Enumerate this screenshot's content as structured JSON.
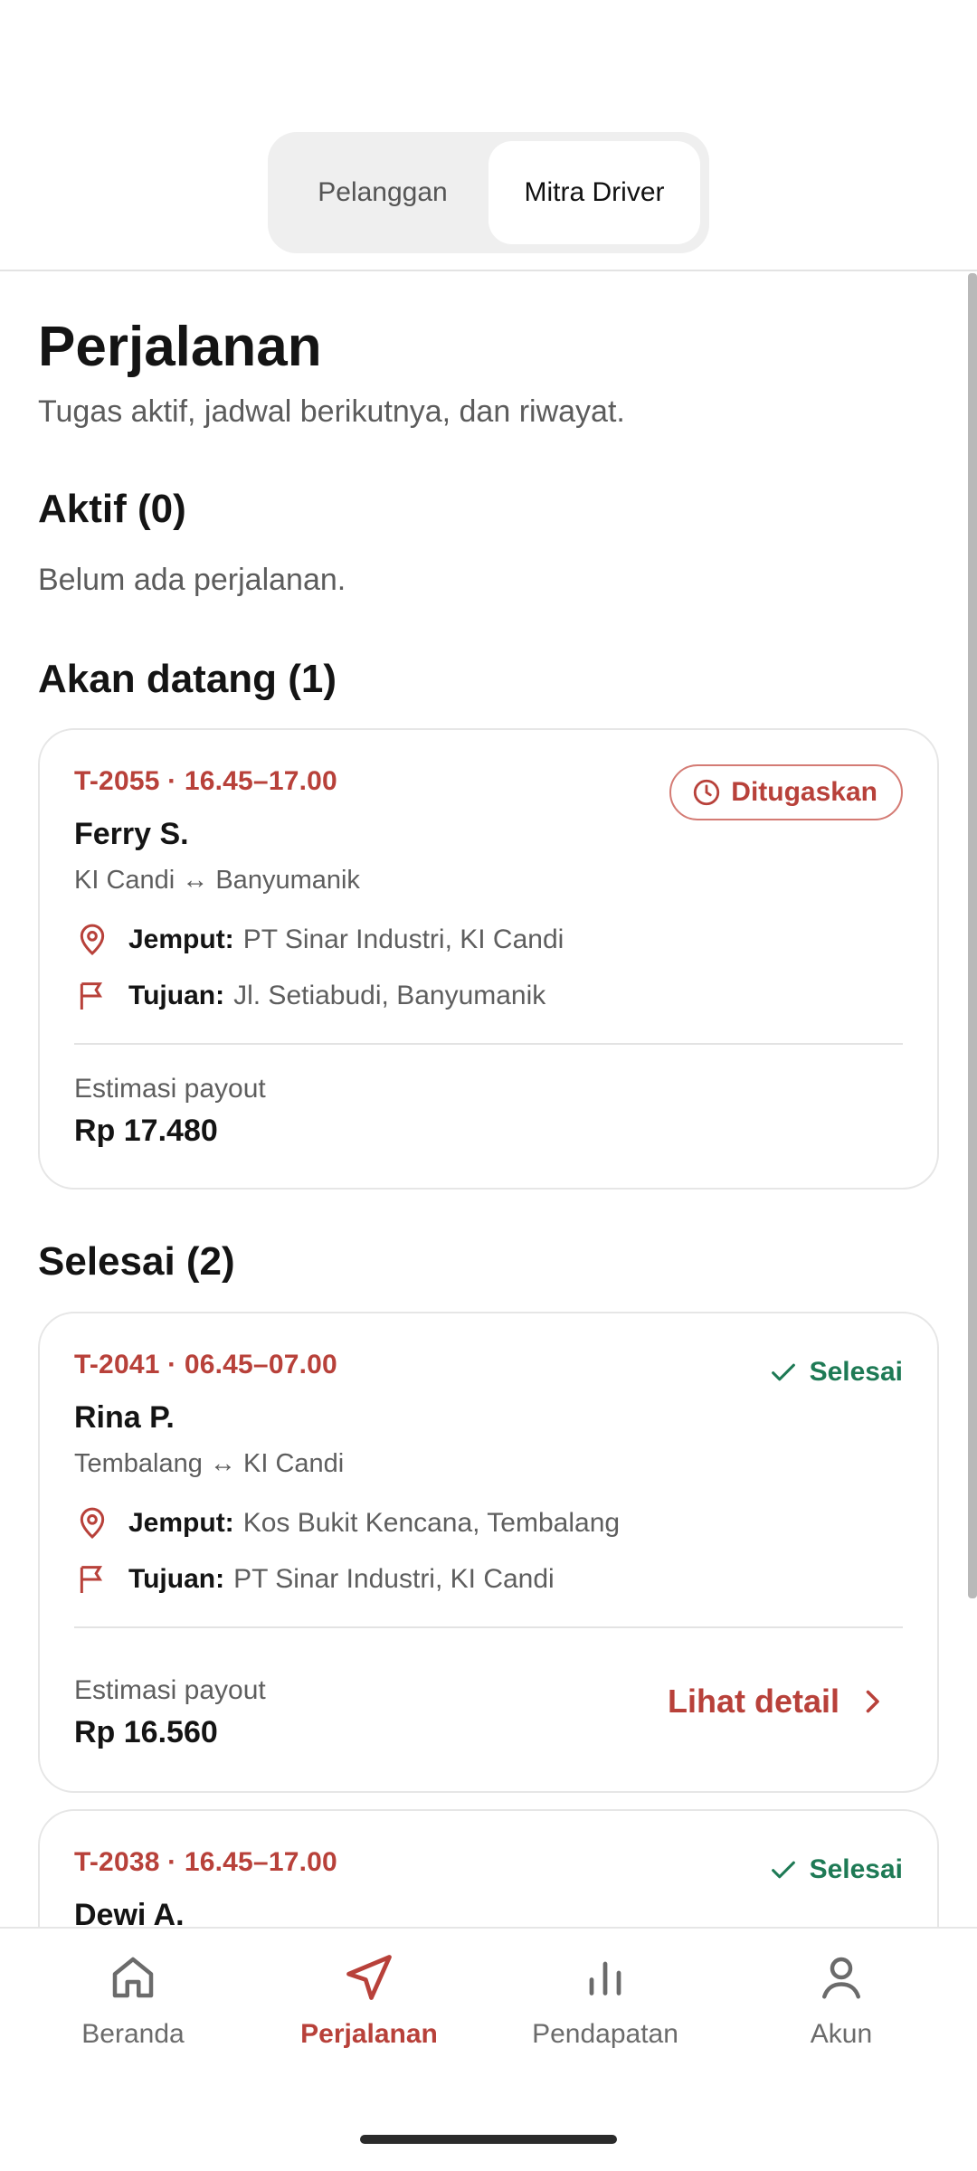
{
  "switcher": {
    "tabs": [
      {
        "label": "Pelanggan"
      },
      {
        "label": "Mitra Driver"
      }
    ]
  },
  "header": {
    "title": "Perjalanan",
    "subtitle": "Tugas aktif, jadwal berikutnya, dan riwayat."
  },
  "sections": {
    "active": {
      "title": "Aktif (0)",
      "empty": "Belum ada perjalanan."
    },
    "upcoming": {
      "title": "Akan datang (1)"
    },
    "done": {
      "title": "Selesai (2)"
    }
  },
  "labels": {
    "pickup": "Jemput:",
    "destination": "Tujuan:",
    "payout": "Estimasi payout",
    "detail": "Lihat detail"
  },
  "trips": [
    {
      "code": "T-2055 · 16.45–17.00",
      "name": "Ferry S.",
      "route": "KI Candi ↔ Banyumanik",
      "pickup": "PT Sinar Industri, KI Candi",
      "destination": "Jl. Setiabudi, Banyumanik",
      "payout": "Rp 17.480",
      "status": "Ditugaskan"
    },
    {
      "code": "T-2041 · 06.45–07.00",
      "name": "Rina P.",
      "route": "Tembalang ↔ KI Candi",
      "pickup": "Kos Bukit Kencana, Tembalang",
      "destination": "PT Sinar Industri, KI Candi",
      "payout": "Rp 16.560",
      "status": "Selesai"
    },
    {
      "code": "T-2038 · 16.45–17.00",
      "name": "Dewi A.",
      "status": "Selesai"
    }
  ],
  "nav": [
    {
      "label": "Beranda",
      "icon": "home-icon"
    },
    {
      "label": "Perjalanan",
      "icon": "navigation-arrow-icon"
    },
    {
      "label": "Pendapatan",
      "icon": "bar-chart-icon"
    },
    {
      "label": "Akun",
      "icon": "user-icon"
    }
  ],
  "colors": {
    "accent": "#b8413a",
    "success": "#1e7a55"
  }
}
